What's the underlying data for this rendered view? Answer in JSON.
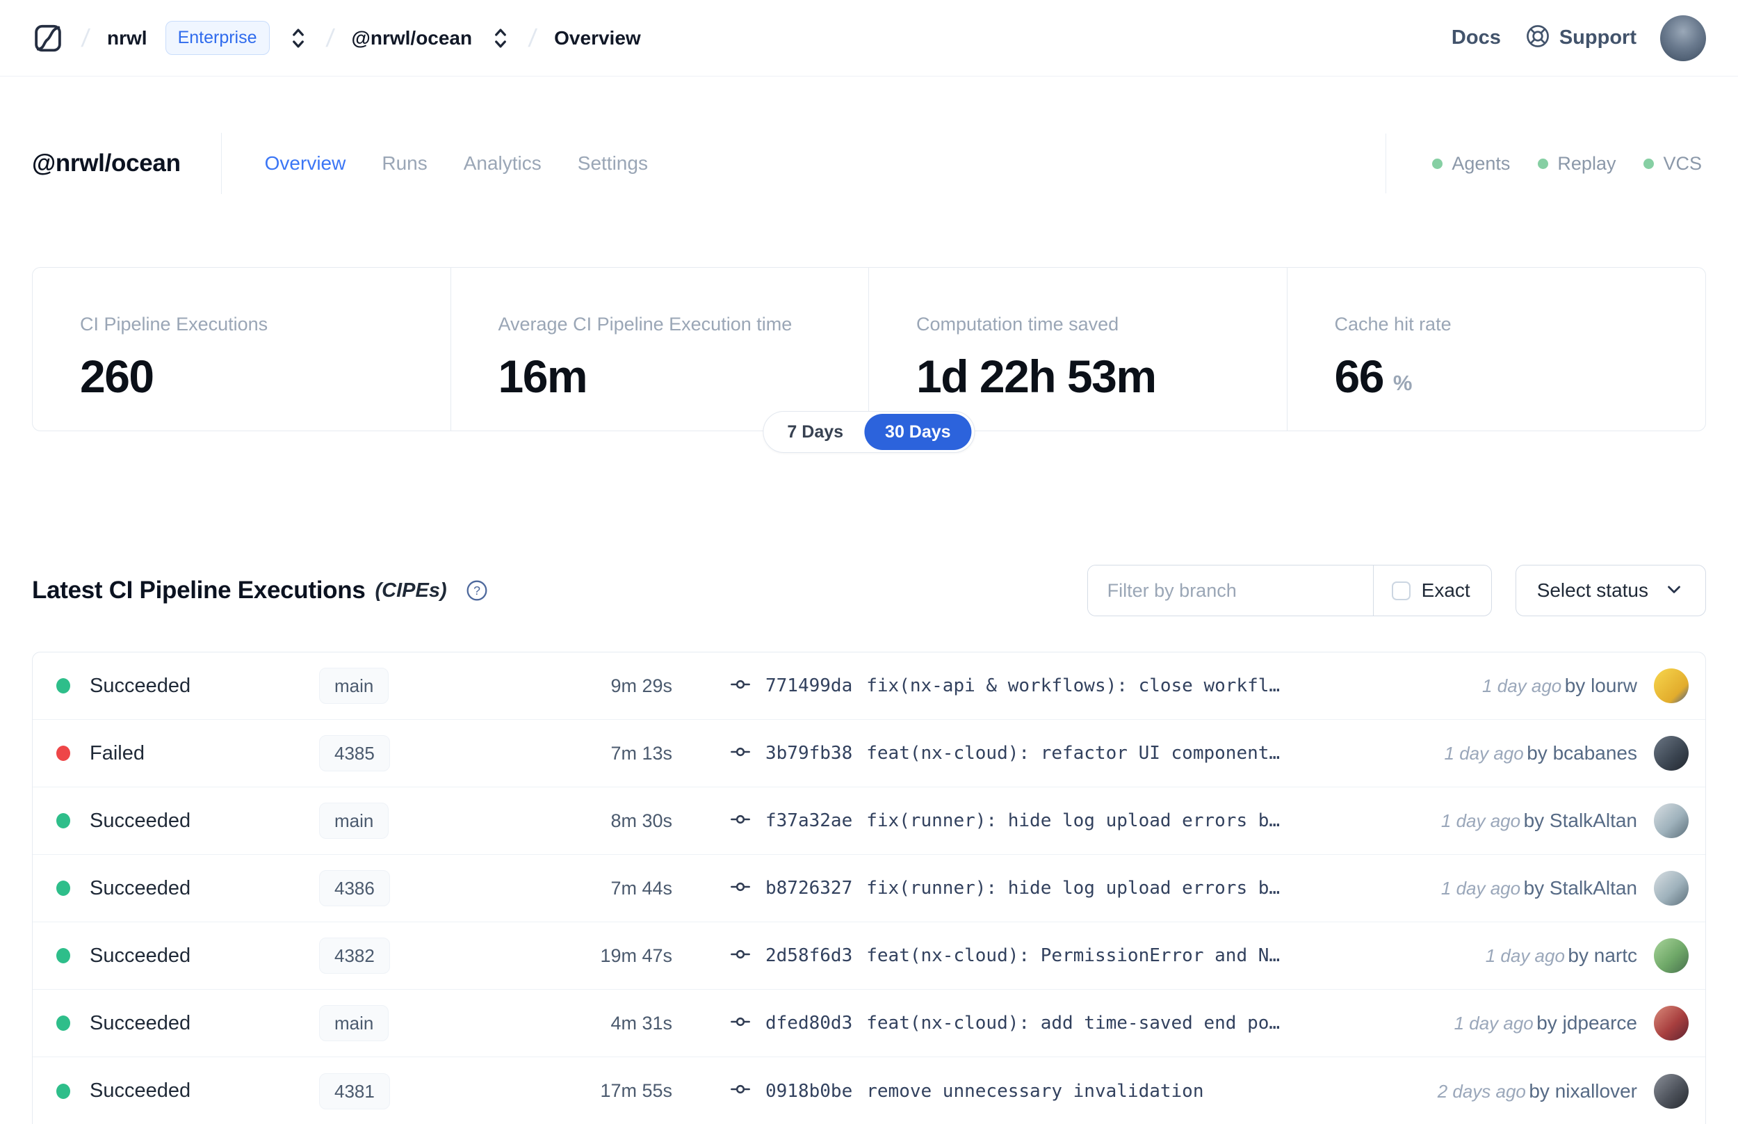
{
  "topbar": {
    "breadcrumb": {
      "org": "nrwl",
      "org_badge": "Enterprise",
      "workspace": "@nrwl/ocean",
      "page": "Overview"
    },
    "docs_label": "Docs",
    "support_label": "Support"
  },
  "header": {
    "title": "@nrwl/ocean",
    "tabs": [
      {
        "label": "Overview",
        "active": true
      },
      {
        "label": "Runs",
        "active": false
      },
      {
        "label": "Analytics",
        "active": false
      },
      {
        "label": "Settings",
        "active": false
      }
    ],
    "services": [
      {
        "label": "Agents",
        "status_color": "#86cfa3"
      },
      {
        "label": "Replay",
        "status_color": "#86cfa3"
      },
      {
        "label": "VCS",
        "status_color": "#86cfa3"
      }
    ]
  },
  "stats": {
    "cards": [
      {
        "label": "CI Pipeline Executions",
        "value": "260",
        "suffix": ""
      },
      {
        "label": "Average CI Pipeline Execution time",
        "value": "16m",
        "suffix": ""
      },
      {
        "label": "Computation time saved",
        "value": "1d 22h 53m",
        "suffix": ""
      },
      {
        "label": "Cache hit rate",
        "value": "66",
        "suffix": "%"
      }
    ],
    "range_toggle": {
      "options": [
        "7 Days",
        "30 Days"
      ],
      "selected": "30 Days",
      "active_color": "#2c63dc"
    }
  },
  "cipes": {
    "title": "Latest CI Pipeline Executions",
    "title_suffix": "(CIPEs)",
    "filter_placeholder": "Filter by branch",
    "exact_label": "Exact",
    "select_status_label": "Select status",
    "by_label": "by",
    "status_colors": {
      "succeeded": "#2ebe8a",
      "failed": "#ee4648"
    },
    "rows": [
      {
        "status": "Succeeded",
        "status_color": "#2ebe8a",
        "branch": "main",
        "duration": "9m 29s",
        "commit_hash": "771499da",
        "commit_message": "fix(nx-api & workflows): close workfl…",
        "time_ago": "1 day ago",
        "author": "lourw",
        "avatar_color": "linear-gradient(135deg,#f7d64e 0%,#e2ac2c 70%,#3d5a92 100%)"
      },
      {
        "status": "Failed",
        "status_color": "#ee4648",
        "branch": "4385",
        "duration": "7m 13s",
        "commit_hash": "3b79fb38",
        "commit_message": "feat(nx-cloud): refactor UI component…",
        "time_ago": "1 day ago",
        "author": "bcabanes",
        "avatar_color": "linear-gradient(135deg,#6b7684 0%,#3a4450 60%,#22272f 100%)"
      },
      {
        "status": "Succeeded",
        "status_color": "#2ebe8a",
        "branch": "main",
        "duration": "8m 30s",
        "commit_hash": "f37a32ae",
        "commit_message": "fix(runner): hide log upload errors b…",
        "time_ago": "1 day ago",
        "author": "StalkAltan",
        "avatar_color": "linear-gradient(135deg,#d7dee2 0%,#9fb2bc 55%,#5c6f7a 100%)"
      },
      {
        "status": "Succeeded",
        "status_color": "#2ebe8a",
        "branch": "4386",
        "duration": "7m 44s",
        "commit_hash": "b8726327",
        "commit_message": "fix(runner): hide log upload errors b…",
        "time_ago": "1 day ago",
        "author": "StalkAltan",
        "avatar_color": "linear-gradient(135deg,#d7dee2 0%,#9fb2bc 55%,#5c6f7a 100%)"
      },
      {
        "status": "Succeeded",
        "status_color": "#2ebe8a",
        "branch": "4382",
        "duration": "19m 47s",
        "commit_hash": "2d58f6d3",
        "commit_message": "feat(nx-cloud): PermissionError and N…",
        "time_ago": "1 day ago",
        "author": "nartc",
        "avatar_color": "linear-gradient(135deg,#a8d49a 0%,#6fa868 55%,#47704d 100%)"
      },
      {
        "status": "Succeeded",
        "status_color": "#2ebe8a",
        "branch": "main",
        "duration": "4m 31s",
        "commit_hash": "dfed80d3",
        "commit_message": "feat(nx-cloud): add time-saved end po…",
        "time_ago": "1 day ago",
        "author": "jdpearce",
        "avatar_color": "linear-gradient(135deg,#d98a7a 0%,#a83f3f 55%,#5e2430 100%)"
      },
      {
        "status": "Succeeded",
        "status_color": "#2ebe8a",
        "branch": "4381",
        "duration": "17m 55s",
        "commit_hash": "0918b0be",
        "commit_message": "remove unnecessary invalidation",
        "time_ago": "2 days ago",
        "author": "nixallover",
        "avatar_color": "linear-gradient(135deg,#8a8f98 0%,#4e535c 55%,#26292f 100%)"
      }
    ]
  }
}
